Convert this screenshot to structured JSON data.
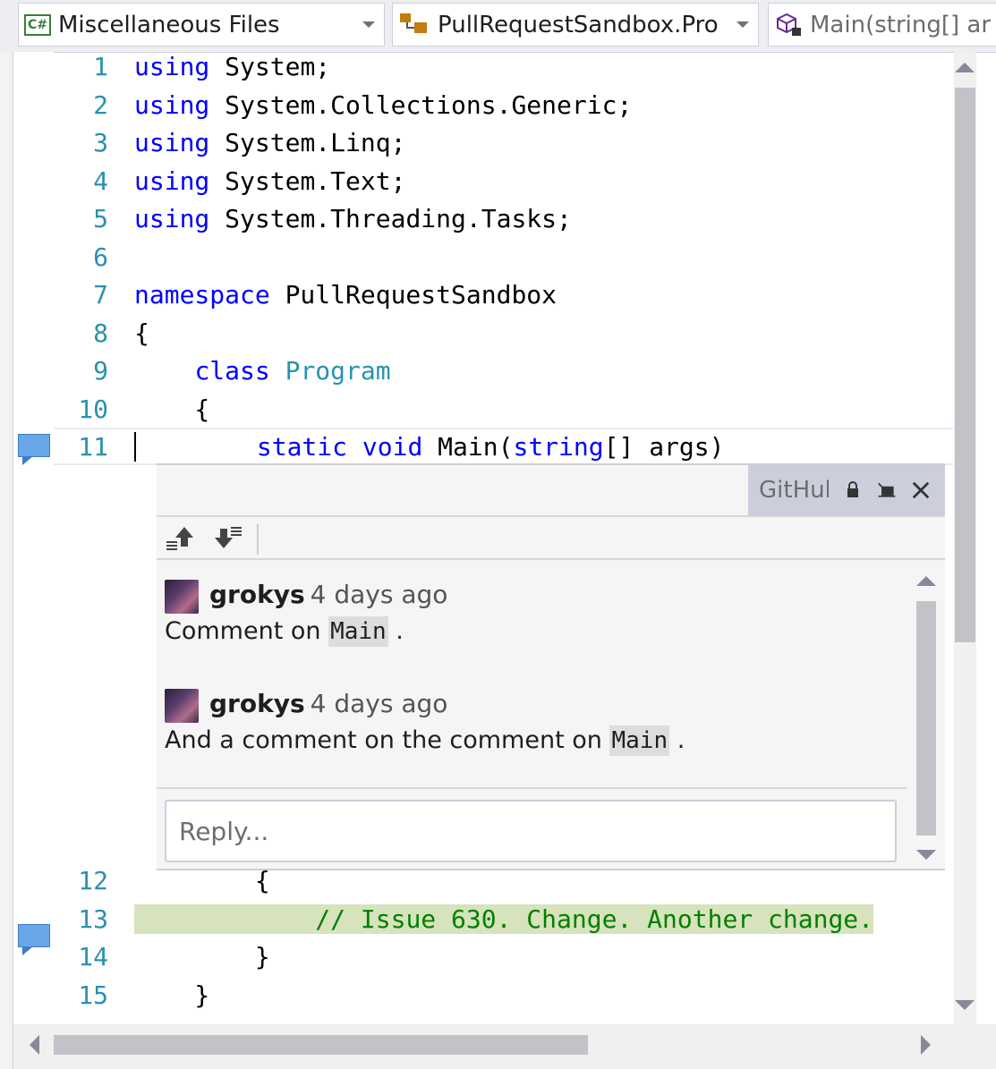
{
  "navbar": {
    "file_dropdown": "Miscellaneous Files",
    "file_icon": "C#",
    "project_dropdown": "PullRequestSandbox.Pro",
    "member_dropdown": "Main(string[] ar"
  },
  "code_lines": [
    {
      "num": "1",
      "parts": [
        {
          "t": "kw",
          "s": "using"
        },
        {
          "t": "",
          "s": " System;"
        }
      ]
    },
    {
      "num": "2",
      "parts": [
        {
          "t": "kw",
          "s": "using"
        },
        {
          "t": "",
          "s": " System.Collections.Generic;"
        }
      ]
    },
    {
      "num": "3",
      "parts": [
        {
          "t": "kw",
          "s": "using"
        },
        {
          "t": "",
          "s": " System.Linq;"
        }
      ]
    },
    {
      "num": "4",
      "parts": [
        {
          "t": "kw",
          "s": "using"
        },
        {
          "t": "",
          "s": " System.Text;"
        }
      ]
    },
    {
      "num": "5",
      "parts": [
        {
          "t": "kw",
          "s": "using"
        },
        {
          "t": "",
          "s": " System.Threading.Tasks;"
        }
      ]
    },
    {
      "num": "6",
      "parts": []
    },
    {
      "num": "7",
      "parts": [
        {
          "t": "kw",
          "s": "namespace"
        },
        {
          "t": "",
          "s": " PullRequestSandbox"
        }
      ]
    },
    {
      "num": "8",
      "parts": [
        {
          "t": "",
          "s": "{"
        }
      ]
    },
    {
      "num": "9",
      "parts": [
        {
          "t": "",
          "s": "    "
        },
        {
          "t": "kw",
          "s": "class"
        },
        {
          "t": "",
          "s": " "
        },
        {
          "t": "ty",
          "s": "Program"
        }
      ]
    },
    {
      "num": "10",
      "parts": [
        {
          "t": "",
          "s": "    {"
        }
      ]
    },
    {
      "num": "11",
      "parts": [
        {
          "t": "",
          "s": "        "
        },
        {
          "t": "kw",
          "s": "static"
        },
        {
          "t": "",
          "s": " "
        },
        {
          "t": "kw",
          "s": "void"
        },
        {
          "t": "",
          "s": " Main("
        },
        {
          "t": "kw",
          "s": "string"
        },
        {
          "t": "",
          "s": "[] args)"
        }
      ]
    },
    {
      "num": "12",
      "parts": [
        {
          "t": "",
          "s": "        {"
        }
      ]
    },
    {
      "num": "13",
      "parts": [
        {
          "t": "",
          "s": "            "
        },
        {
          "t": "cm",
          "s": "// Issue 630. Change. Another change."
        }
      ]
    },
    {
      "num": "14",
      "parts": [
        {
          "t": "",
          "s": "        }"
        }
      ]
    },
    {
      "num": "15",
      "parts": [
        {
          "t": "",
          "s": "    }"
        }
      ]
    }
  ],
  "peek": {
    "tab_title": "GitHub",
    "comments": [
      {
        "author": "grokys",
        "when": "4 days ago",
        "text_before": "Comment on ",
        "code": "Main",
        "text_after": " ."
      },
      {
        "author": "grokys",
        "when": "4 days ago",
        "text_before": "And a comment on the comment on ",
        "code": "Main",
        "text_after": " ."
      }
    ],
    "reply_placeholder": "Reply..."
  },
  "colors": {
    "keyword": "#0000ff",
    "type": "#2b91af",
    "comment": "#008000",
    "line_number": "#2b91af",
    "changed_line_bg": "#d7e3bc",
    "comment_glyph": "#6aa7e8"
  }
}
